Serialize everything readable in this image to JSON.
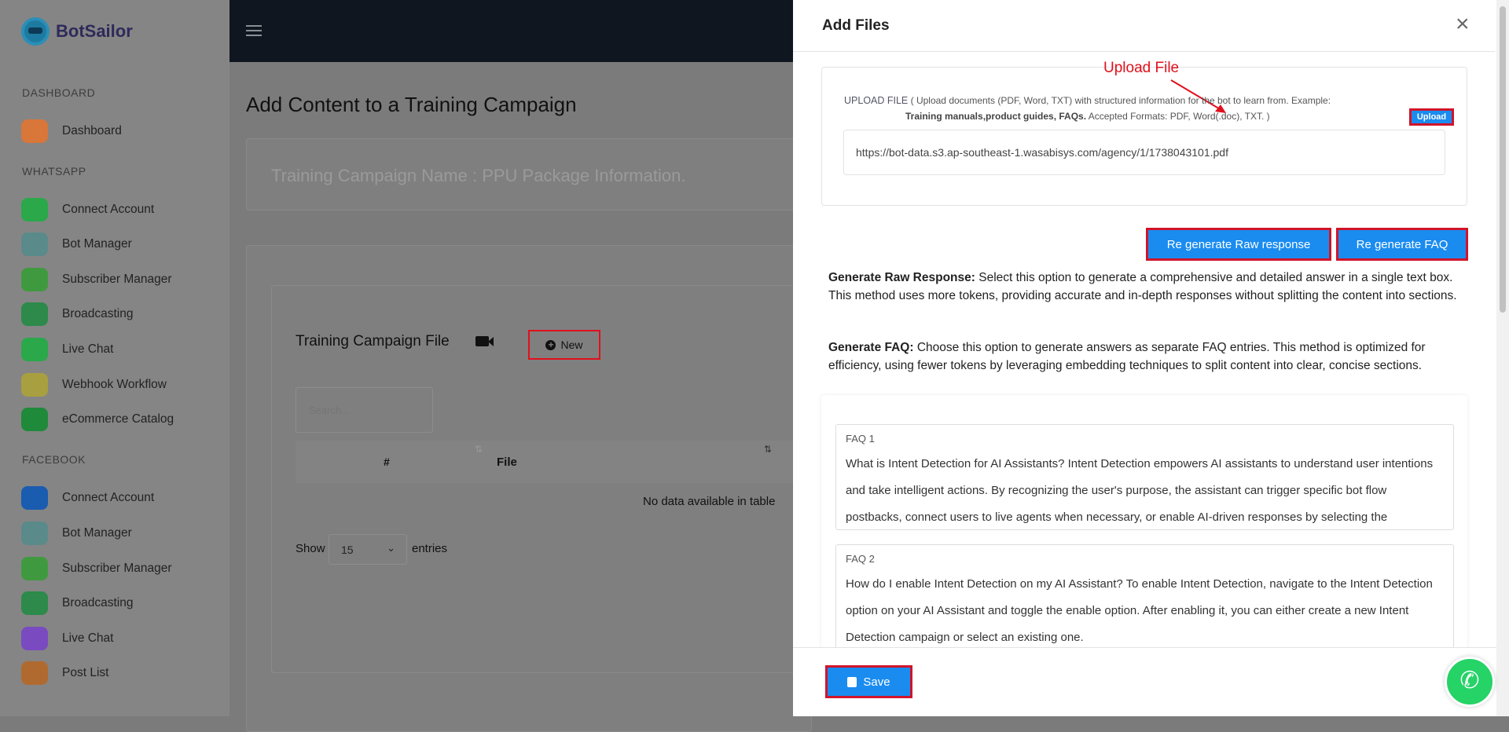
{
  "sidebar": {
    "brand": "BotSailor",
    "sections": [
      {
        "title": "DASHBOARD",
        "items": [
          {
            "label": "Dashboard",
            "icon": "dashboard-gauge-icon"
          }
        ]
      },
      {
        "title": "WHATSAPP",
        "items": [
          {
            "label": "Connect Account",
            "icon": "whatsapp-business-icon"
          },
          {
            "label": "Bot Manager",
            "icon": "bot-icon"
          },
          {
            "label": "Subscriber Manager",
            "icon": "subscriber-book-icon"
          },
          {
            "label": "Broadcasting",
            "icon": "broadcast-plane-icon"
          },
          {
            "label": "Live Chat",
            "icon": "whatsapp-icon"
          },
          {
            "label": "Webhook Workflow",
            "icon": "webhook-icon"
          },
          {
            "label": "eCommerce Catalog",
            "icon": "shopping-bag-icon"
          }
        ]
      },
      {
        "title": "FACEBOOK",
        "items": [
          {
            "label": "Connect Account",
            "icon": "facebook-icon"
          },
          {
            "label": "Bot Manager",
            "icon": "bot-icon"
          },
          {
            "label": "Subscriber Manager",
            "icon": "subscriber-book-icon"
          },
          {
            "label": "Broadcasting",
            "icon": "broadcast-plane-icon"
          },
          {
            "label": "Live Chat",
            "icon": "messenger-icon"
          },
          {
            "label": "Post List",
            "icon": "post-list-icon"
          }
        ]
      }
    ]
  },
  "main": {
    "title": "Add Content to a Training Campaign",
    "campaign_name": "Training Campaign Name : PPU Package Information.",
    "file_section": {
      "title": "Training Campaign File",
      "new_label": "New",
      "search_placeholder": "Search...",
      "columns": [
        "#",
        "File"
      ],
      "empty": "No data available in table",
      "show": "Show",
      "entries_value": "15",
      "entries": "entries"
    }
  },
  "modal": {
    "title": "Add Files",
    "upload": {
      "label": "UPLOAD FILE",
      "help1": "( Upload documents (PDF, Word, TXT) with structured information for the bot to learn from. Example:",
      "help_bold": "Training manuals,product guides, FAQs.",
      "help2": " Accepted Formats: PDF, Word(.doc), TXT. )",
      "button": "Upload",
      "annotation": "Upload File",
      "value": "https://bot-data.s3.ap-southeast-1.wasabisys.com/agency/1/1738043101.pdf"
    },
    "buttons": {
      "raw": "Re generate Raw response",
      "faq": "Re generate FAQ"
    },
    "desc_raw_bold": "Generate Raw Response:",
    "desc_raw": " Select this option to generate a comprehensive and detailed answer in a single text box. This method uses more tokens, providing accurate and in-depth responses without splitting the content into sections.",
    "desc_faq_bold": "Generate FAQ:",
    "desc_faq": " Choose this option to generate answers as separate FAQ entries. This method is optimized for efficiency, using fewer tokens by leveraging embedding techniques to split content into clear, concise sections.",
    "faqs": [
      {
        "label": "FAQ 1",
        "text": " What is Intent Detection for AI Assistants? Intent Detection empowers AI assistants to understand user intentions and take intelligent actions. By recognizing the user's purpose, the assistant can trigger specific bot flow postbacks, connect users to live agents when necessary, or enable AI-driven responses by selecting the"
      },
      {
        "label": "FAQ 2",
        "text": " How do I enable Intent Detection on my AI Assistant? To enable Intent Detection, navigate to the Intent Detection option on your AI Assistant and toggle the enable option. After enabling it, you can either create a new Intent Detection campaign or select an existing one."
      }
    ],
    "save": "Save"
  },
  "colors": {
    "accent": "#1a8cf0",
    "highlight": "#d0142a",
    "whatsapp": "#25d366"
  }
}
